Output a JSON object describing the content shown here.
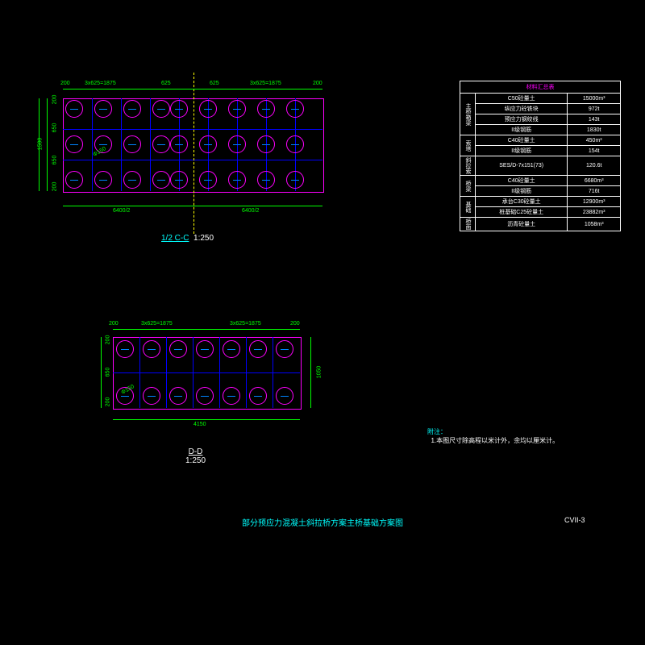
{
  "viewCC": {
    "label_u": "1/2 C-C",
    "scale": "1:250",
    "dims": {
      "left_200": "200",
      "span1": "3x625=1875",
      "gap1": "625",
      "gap2": "625",
      "span2": "3x625=1875",
      "right_200": "200",
      "top_200": "200",
      "v_gap": "650",
      "v_total": "1500",
      "bot_half": "6400/2",
      "bot_half2": "6400/2",
      "pile_diam": "Φ150"
    }
  },
  "viewDD": {
    "label": "D-D",
    "scale": "1:250",
    "dims": {
      "left_200": "200",
      "span1": "3x625=1875",
      "span2": "3x625=1875",
      "right_200": "200",
      "top_200": "200",
      "v_gap": "650",
      "v_total": "1050",
      "bottom": "4150",
      "pile_diam": "Φ150"
    }
  },
  "table": {
    "title": "材料汇总表",
    "rows": [
      {
        "cat": "主桥箱梁",
        "name": "C50砼量土",
        "val": "15000m³"
      },
      {
        "cat": "",
        "name": "纵应力砼铁块",
        "val": "972t"
      },
      {
        "cat": "",
        "name": "预应力钢绞线",
        "val": "143t"
      },
      {
        "cat": "",
        "name": "II级钢筋",
        "val": "1830t"
      },
      {
        "cat": "索塔",
        "name": "C40砼量土",
        "val": "450m³"
      },
      {
        "cat": "",
        "name": "II级钢筋",
        "val": "154t"
      },
      {
        "cat": "斜拉索",
        "name": "SES/D-7x151(73)",
        "val": "120.6t"
      },
      {
        "cat": "桥梁",
        "name": "C40砼量土",
        "val": "6680m³"
      },
      {
        "cat": "",
        "name": "II级钢筋",
        "val": "716t"
      },
      {
        "cat": "基础",
        "name": "承台C30砼量土",
        "val": "12900m³"
      },
      {
        "cat": "",
        "name": "桩基础C25砼量土",
        "val": "23882m³"
      },
      {
        "cat": "桥面",
        "name": "沥青砼量土",
        "val": "1058m³"
      }
    ]
  },
  "notes": {
    "head": "附注：",
    "line1": "1.本图尺寸除高程以米计外，余均以厘米计。"
  },
  "drawing_title": "部分预应力混凝土斜拉桥方案主桥基础方案图",
  "sheet_no": "CVII-3"
}
